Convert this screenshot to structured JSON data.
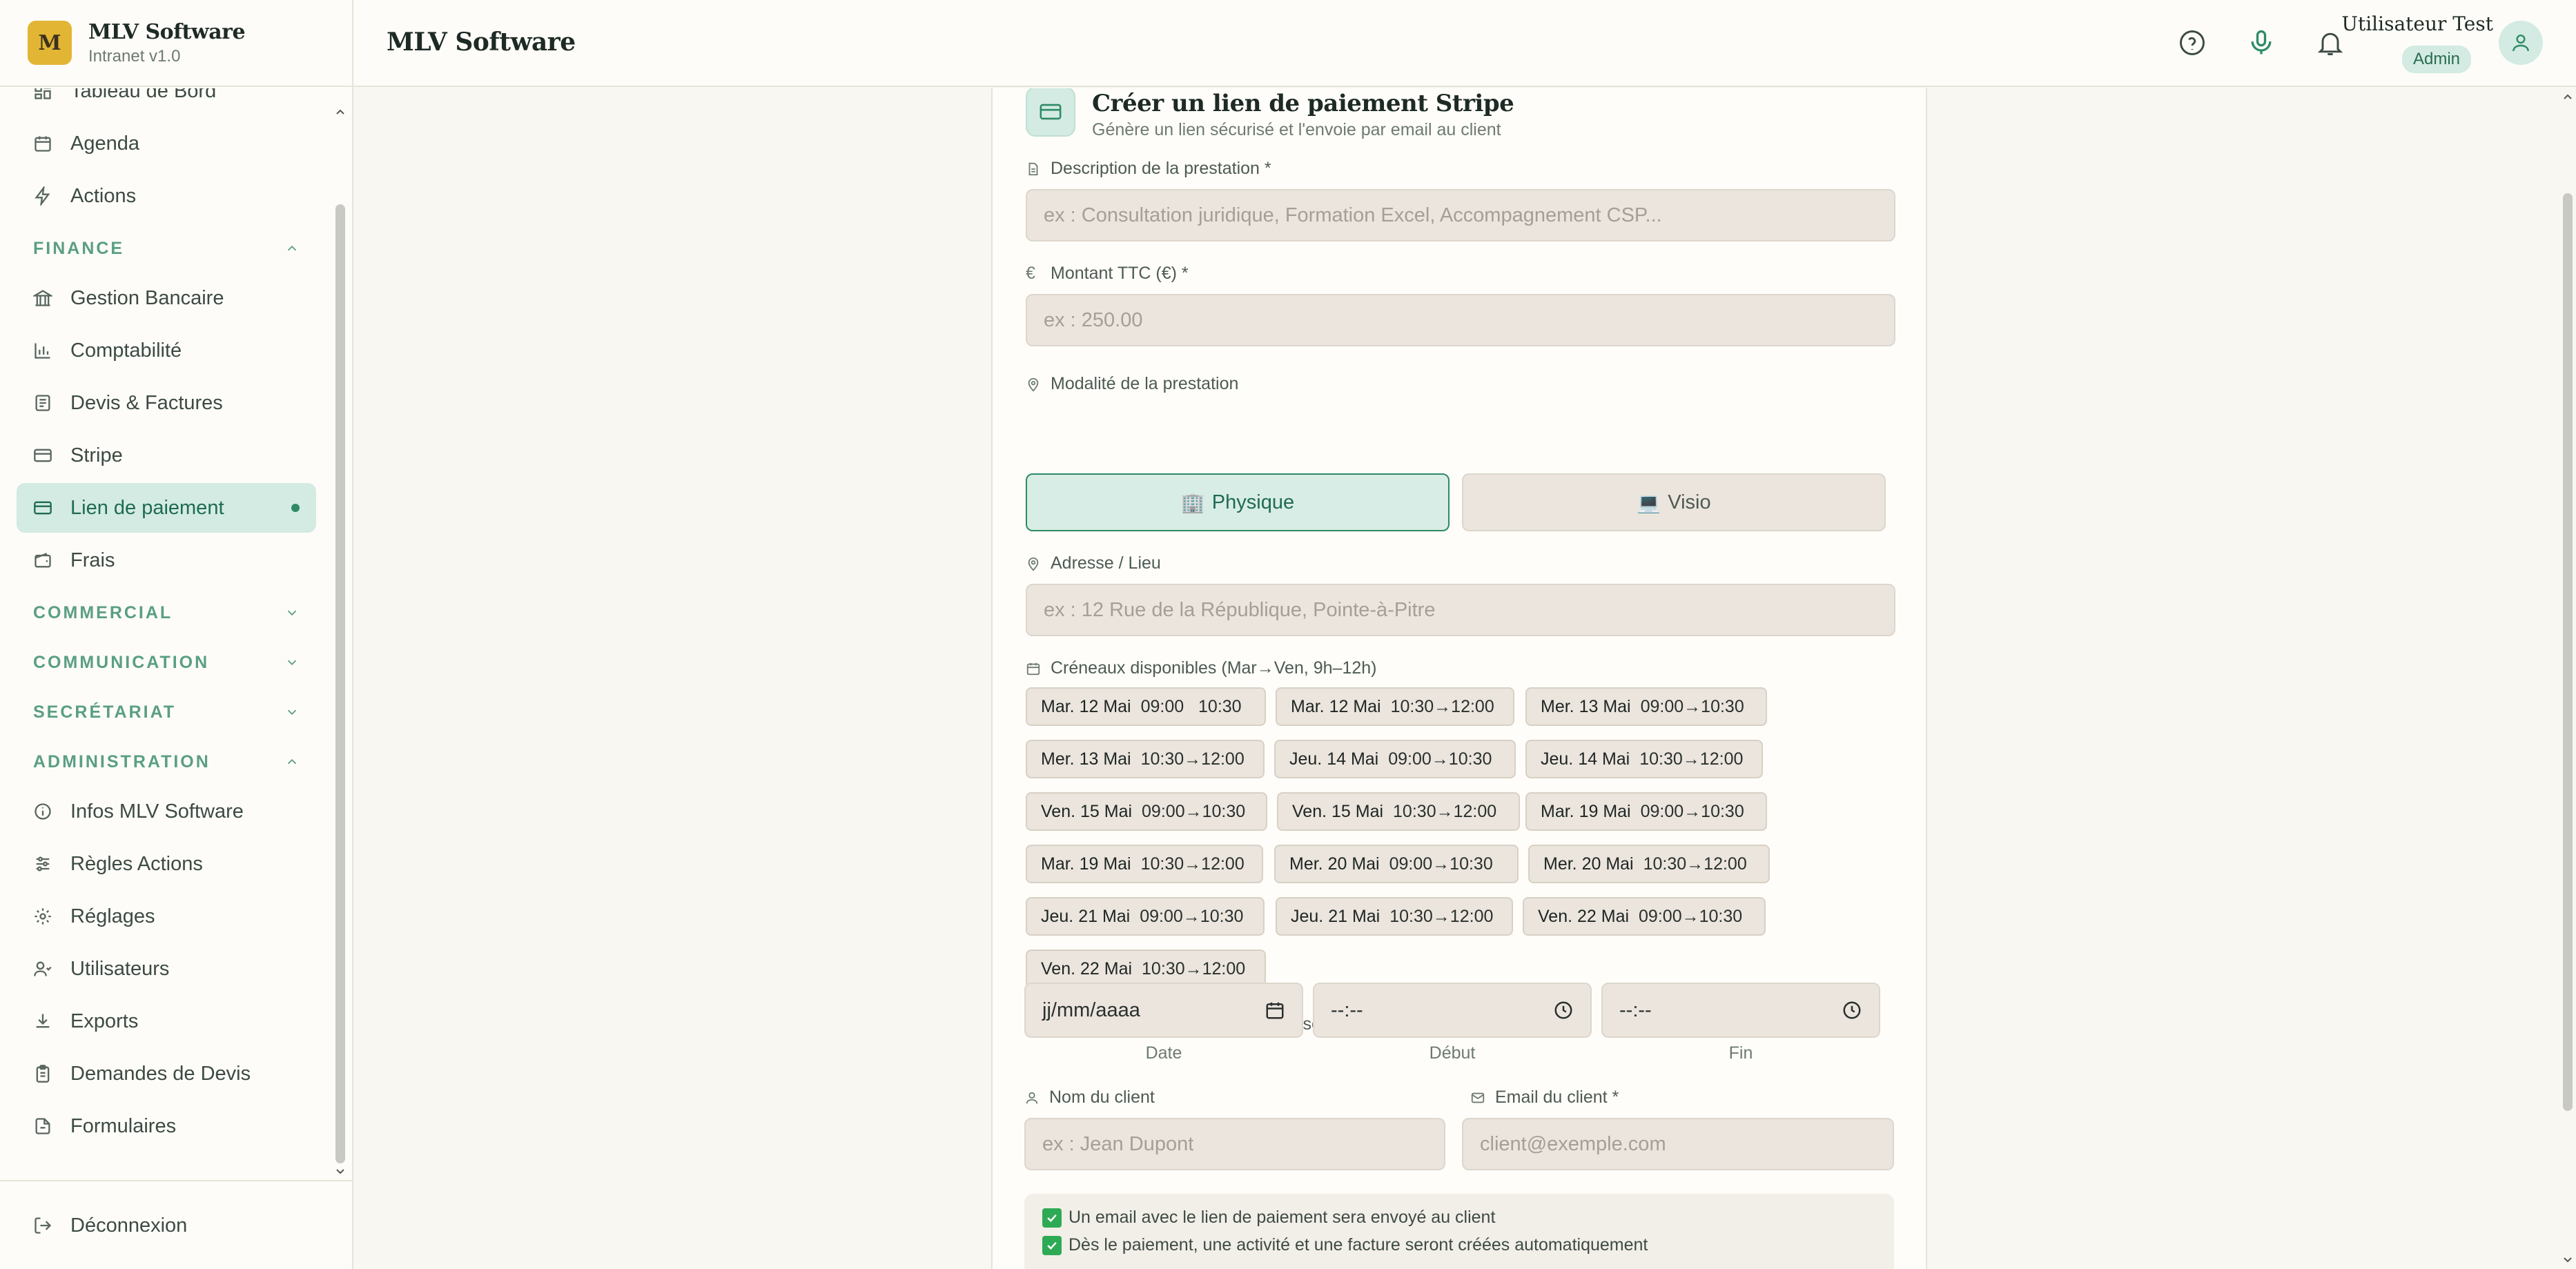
{
  "brand": {
    "logo_letter": "M",
    "name": "MLV Software",
    "version": "Intranet v1.0"
  },
  "sidebar": {
    "top_items": [
      {
        "label": "Tableau de Bord",
        "icon": "dashboard-icon"
      },
      {
        "label": "Agenda",
        "icon": "calendar-icon"
      },
      {
        "label": "Actions",
        "icon": "lightning-icon"
      }
    ],
    "finance": {
      "label": "FINANCE",
      "items": [
        {
          "label": "Gestion Bancaire",
          "icon": "bank-icon"
        },
        {
          "label": "Comptabilité",
          "icon": "bar-chart-icon"
        },
        {
          "label": "Devis & Factures",
          "icon": "invoice-icon"
        },
        {
          "label": "Stripe",
          "icon": "card-icon"
        },
        {
          "label": "Lien de paiement",
          "icon": "card-icon",
          "active": true
        },
        {
          "label": "Frais",
          "icon": "wallet-icon"
        }
      ]
    },
    "commercial": {
      "label": "COMMERCIAL"
    },
    "communication": {
      "label": "COMMUNICATION"
    },
    "secretariat": {
      "label": "SECRÉTARIAT"
    },
    "administration": {
      "label": "ADMINISTRATION",
      "items": [
        {
          "label": "Infos MLV Software",
          "icon": "info-icon"
        },
        {
          "label": "Règles Actions",
          "icon": "sliders-icon"
        },
        {
          "label": "Réglages",
          "icon": "gear-icon"
        },
        {
          "label": "Utilisateurs",
          "icon": "users-icon"
        },
        {
          "label": "Exports",
          "icon": "download-icon"
        },
        {
          "label": "Demandes de Devis",
          "icon": "clipboard-icon"
        },
        {
          "label": "Formulaires",
          "icon": "form-icon"
        }
      ]
    },
    "logout": "Déconnexion"
  },
  "header": {
    "title": "MLV Software",
    "user_name": "Utilisateur Test",
    "user_role": "Admin"
  },
  "form": {
    "title": "Créer un lien de paiement Stripe",
    "subtitle": "Génère un lien sécurisé et l'envoie par email au client",
    "description_label": "Description de la prestation *",
    "description_placeholder": "ex : Consultation juridique, Formation Excel, Accompagnement CSP...",
    "amount_label": "Montant TTC (€) *",
    "amount_placeholder": "ex : 250.00",
    "mode_label": "Modalité de la prestation",
    "mode_physique": "Physique",
    "mode_visio": "Visio",
    "address_label": "Adresse / Lieu",
    "address_placeholder": "ex : 12 Rue de la République, Pointe-à-Pitre",
    "slots_label": "Créneaux disponibles (Mar→Ven, 9h–12h)",
    "slots": [
      {
        "day": "Mar. 12 Mai",
        "time": "09:00   10:30"
      },
      {
        "day": "Mar. 12 Mai",
        "time": "10:30→12:00"
      },
      {
        "day": "Mer. 13 Mai",
        "time": "09:00→10:30"
      },
      {
        "day": "Mer. 13 Mai",
        "time": "10:30→12:00"
      },
      {
        "day": "Jeu. 14 Mai",
        "time": "09:00→10:30"
      },
      {
        "day": "Jeu. 14 Mai",
        "time": "10:30→12:00"
      },
      {
        "day": "Ven. 15 Mai",
        "time": "09:00→10:30"
      },
      {
        "day": "Ven. 15 Mai",
        "time": "10:30→12:00"
      },
      {
        "day": "Mar. 19 Mai",
        "time": "09:00→10:30"
      },
      {
        "day": "Mar. 19 Mai",
        "time": "10:30→12:00"
      },
      {
        "day": "Mer. 20 Mai",
        "time": "09:00→10:30"
      },
      {
        "day": "Mer. 20 Mai",
        "time": "10:30→12:00"
      },
      {
        "day": "Jeu. 21 Mai",
        "time": "09:00→10:30"
      },
      {
        "day": "Jeu. 21 Mai",
        "time": "10:30→12:00"
      },
      {
        "day": "Ven. 22 Mai",
        "time": "09:00→10:30"
      },
      {
        "day": "Ven. 22 Mai",
        "time": "10:30→12:00"
      }
    ],
    "selected_label": "Créneau sélectionné / personnalisé",
    "date_value": "jj/mm/aaaa",
    "start_value": "--:--",
    "end_value": "--:--",
    "date_caption": "Date",
    "start_caption": "Début",
    "end_caption": "Fin",
    "client_name_label": "Nom du client",
    "client_name_placeholder": "ex : Jean Dupont",
    "client_email_label": "Email du client *",
    "client_email_placeholder": "client@exemple.com",
    "info_lines": [
      "Un email avec le lien de paiement sera envoyé au client",
      "Dès le paiement, une activité et une facture seront créées automatiquement"
    ]
  },
  "colors": {
    "accent": "#2e8a66",
    "active_bg": "#d3ebe2",
    "logo": "#e2b534",
    "input_bg": "#ebe5de"
  }
}
